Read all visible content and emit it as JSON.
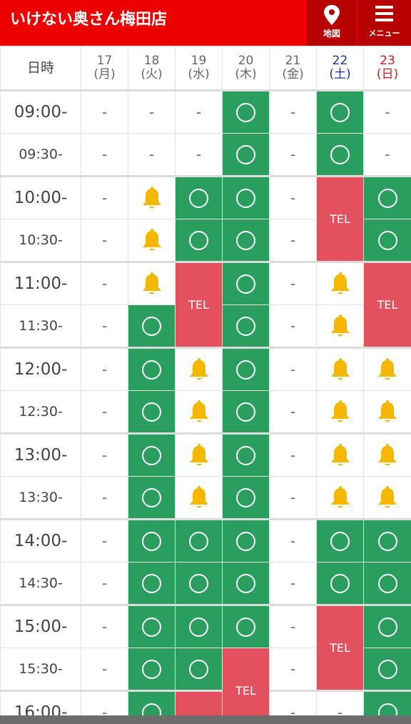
{
  "header": {
    "title": "いけない奥さん梅田店",
    "map_label": "地図",
    "menu_label": "メニュー",
    "colors": {
      "bar": "#ed0000",
      "button": "#b70000"
    }
  },
  "legend": {
    "available": "〇",
    "bell_icon": "bell-icon",
    "tel": "TEL",
    "none": "-"
  },
  "colors": {
    "available": "#2a9e5f",
    "tel": "#e3505e",
    "bell": "#f5b800",
    "saturday": "#1e2fa4",
    "sunday": "#d21d1d"
  },
  "schedule": {
    "corner_label": "日時",
    "days": [
      {
        "date": "17",
        "weekday": "(月)",
        "type": "weekday"
      },
      {
        "date": "18",
        "weekday": "(火)",
        "type": "weekday"
      },
      {
        "date": "19",
        "weekday": "(水)",
        "type": "weekday"
      },
      {
        "date": "20",
        "weekday": "(木)",
        "type": "weekday"
      },
      {
        "date": "21",
        "weekday": "(金)",
        "type": "weekday"
      },
      {
        "date": "22",
        "weekday": "(土)",
        "type": "sat"
      },
      {
        "date": "23",
        "weekday": "(日)",
        "type": "sun"
      }
    ],
    "rows": [
      {
        "time": "09:00-",
        "cells": [
          "-",
          "-",
          "-",
          "O",
          "-",
          "O",
          "-"
        ]
      },
      {
        "time": "09:30-",
        "cells": [
          "-",
          "-",
          "-",
          "O",
          "-",
          "O",
          "-"
        ]
      },
      {
        "time": "10:00-",
        "cells": [
          "-",
          "B",
          "O",
          "O",
          "-",
          "TEL",
          "O"
        ]
      },
      {
        "time": "10:30-",
        "cells": [
          "-",
          "B",
          "O",
          "O",
          "-",
          "^",
          "O"
        ]
      },
      {
        "time": "11:00-",
        "cells": [
          "-",
          "B",
          "TEL",
          "O",
          "-",
          "B",
          "TEL"
        ]
      },
      {
        "time": "11:30-",
        "cells": [
          "-",
          "O",
          "^",
          "O",
          "-",
          "B",
          "^"
        ]
      },
      {
        "time": "12:00-",
        "cells": [
          "-",
          "O",
          "B",
          "O",
          "-",
          "B",
          "B"
        ]
      },
      {
        "time": "12:30-",
        "cells": [
          "-",
          "O",
          "B",
          "O",
          "-",
          "B",
          "B"
        ]
      },
      {
        "time": "13:00-",
        "cells": [
          "-",
          "O",
          "B",
          "O",
          "-",
          "B",
          "B"
        ]
      },
      {
        "time": "13:30-",
        "cells": [
          "-",
          "O",
          "B",
          "O",
          "-",
          "B",
          "B"
        ]
      },
      {
        "time": "14:00-",
        "cells": [
          "-",
          "O",
          "O",
          "O",
          "-",
          "O",
          "O"
        ]
      },
      {
        "time": "14:30-",
        "cells": [
          "-",
          "O",
          "O",
          "O",
          "-",
          "O",
          "O"
        ]
      },
      {
        "time": "15:00-",
        "cells": [
          "-",
          "O",
          "O",
          "O",
          "-",
          "TEL",
          "O"
        ]
      },
      {
        "time": "15:30-",
        "cells": [
          "-",
          "O",
          "O",
          "TEL",
          "-",
          "^",
          "O"
        ]
      },
      {
        "time": "16:00-",
        "cells": [
          "-",
          "O",
          "R",
          "^",
          "-",
          "-",
          "O"
        ]
      }
    ]
  }
}
